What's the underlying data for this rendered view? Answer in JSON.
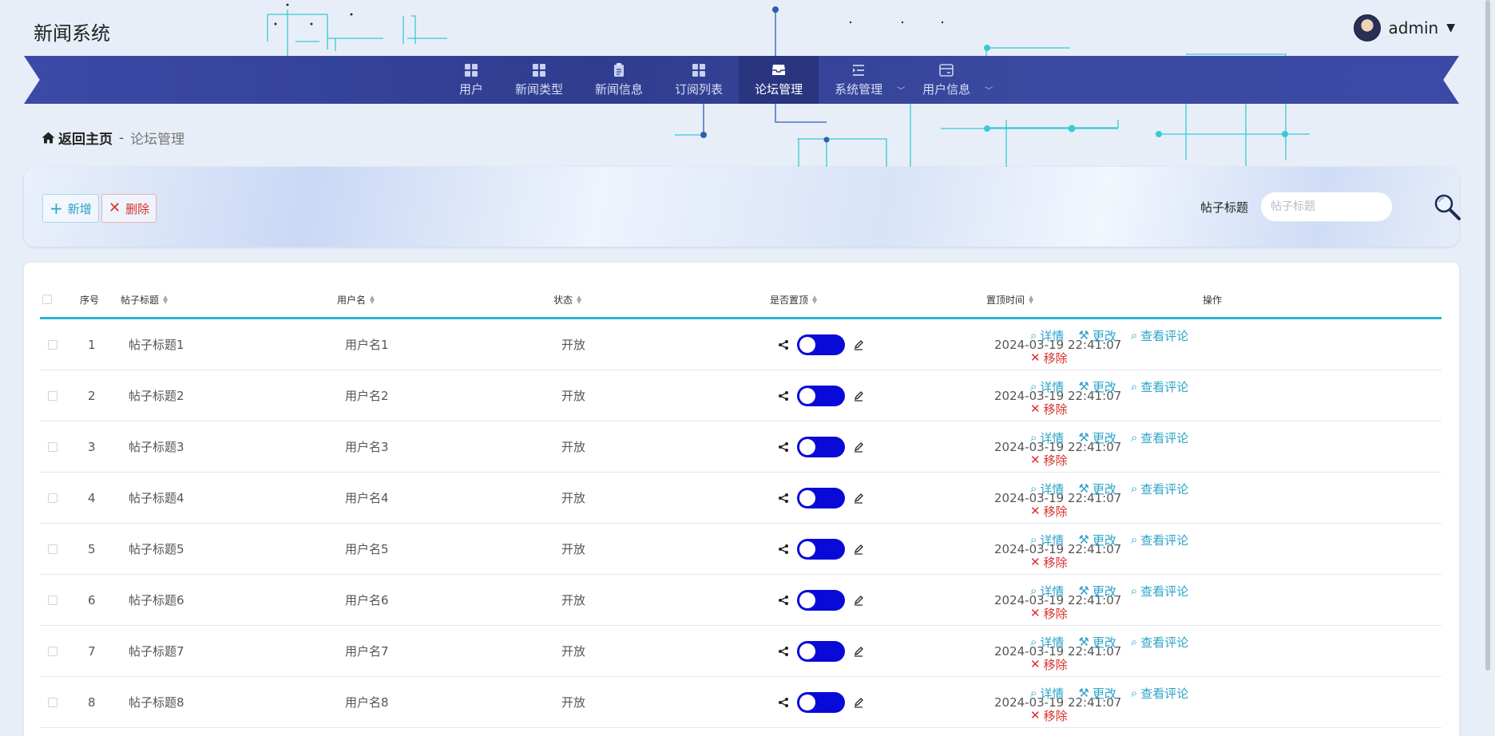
{
  "app": {
    "title": "新闻系统"
  },
  "user": {
    "name": "admin"
  },
  "nav": {
    "items": [
      {
        "label": "用户"
      },
      {
        "label": "新闻类型"
      },
      {
        "label": "新闻信息"
      },
      {
        "label": "订阅列表"
      },
      {
        "label": "论坛管理"
      },
      {
        "label": "系统管理"
      },
      {
        "label": "用户信息"
      }
    ]
  },
  "breadcrumb": {
    "home": "返回主页",
    "separator": "-",
    "current": "论坛管理"
  },
  "toolbar": {
    "add_label": "新增",
    "delete_label": "删除",
    "search_label": "帖子标题",
    "search_placeholder": "帖子标题"
  },
  "table": {
    "columns": [
      "序号",
      "帖子标题",
      "用户名",
      "状态",
      "是否置顶",
      "置顶时间",
      "操作"
    ],
    "actions": {
      "detail": "详情",
      "edit": "更改",
      "comments": "查看评论",
      "remove": "移除"
    },
    "rows": [
      {
        "index": "1",
        "title": "帖子标题1",
        "username": "用户名1",
        "status": "开放",
        "time": "2024-03-19 22:41:07"
      },
      {
        "index": "2",
        "title": "帖子标题2",
        "username": "用户名2",
        "status": "开放",
        "time": "2024-03-19 22:41:07"
      },
      {
        "index": "3",
        "title": "帖子标题3",
        "username": "用户名3",
        "status": "开放",
        "time": "2024-03-19 22:41:07"
      },
      {
        "index": "4",
        "title": "帖子标题4",
        "username": "用户名4",
        "status": "开放",
        "time": "2024-03-19 22:41:07"
      },
      {
        "index": "5",
        "title": "帖子标题5",
        "username": "用户名5",
        "status": "开放",
        "time": "2024-03-19 22:41:07"
      },
      {
        "index": "6",
        "title": "帖子标题6",
        "username": "用户名6",
        "status": "开放",
        "time": "2024-03-19 22:41:07"
      },
      {
        "index": "7",
        "title": "帖子标题7",
        "username": "用户名7",
        "status": "开放",
        "time": "2024-03-19 22:41:07"
      },
      {
        "index": "8",
        "title": "帖子标题8",
        "username": "用户名8",
        "status": "开放",
        "time": "2024-03-19 22:41:07"
      }
    ]
  },
  "colors": {
    "nav": "#2f3d8f",
    "nav_active": "#2a3580",
    "accent": "#2aa3c8",
    "danger": "#d9302c",
    "toggle": "#0a0ad8",
    "table_header_line": "#28b3d2"
  },
  "icons": {
    "home": "home-icon",
    "search": "search-icon",
    "add": "plus-icon",
    "delete": "close-icon"
  }
}
